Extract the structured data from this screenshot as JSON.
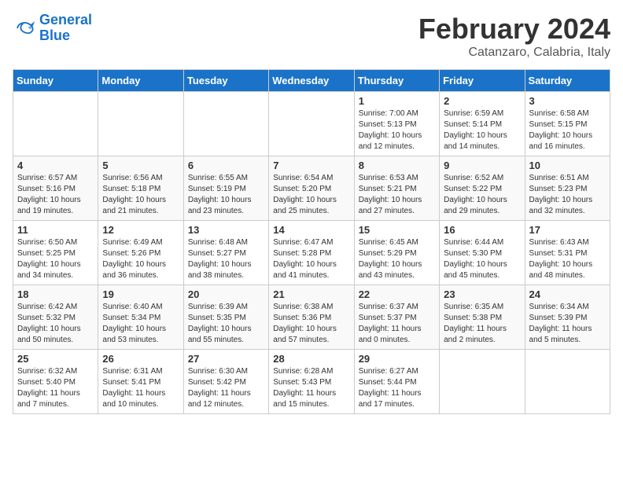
{
  "logo": {
    "line1": "General",
    "line2": "Blue"
  },
  "title": "February 2024",
  "subtitle": "Catanzaro, Calabria, Italy",
  "days_of_week": [
    "Sunday",
    "Monday",
    "Tuesday",
    "Wednesday",
    "Thursday",
    "Friday",
    "Saturday"
  ],
  "weeks": [
    [
      {
        "day": "",
        "info": ""
      },
      {
        "day": "",
        "info": ""
      },
      {
        "day": "",
        "info": ""
      },
      {
        "day": "",
        "info": ""
      },
      {
        "day": "1",
        "info": "Sunrise: 7:00 AM\nSunset: 5:13 PM\nDaylight: 10 hours\nand 12 minutes."
      },
      {
        "day": "2",
        "info": "Sunrise: 6:59 AM\nSunset: 5:14 PM\nDaylight: 10 hours\nand 14 minutes."
      },
      {
        "day": "3",
        "info": "Sunrise: 6:58 AM\nSunset: 5:15 PM\nDaylight: 10 hours\nand 16 minutes."
      }
    ],
    [
      {
        "day": "4",
        "info": "Sunrise: 6:57 AM\nSunset: 5:16 PM\nDaylight: 10 hours\nand 19 minutes."
      },
      {
        "day": "5",
        "info": "Sunrise: 6:56 AM\nSunset: 5:18 PM\nDaylight: 10 hours\nand 21 minutes."
      },
      {
        "day": "6",
        "info": "Sunrise: 6:55 AM\nSunset: 5:19 PM\nDaylight: 10 hours\nand 23 minutes."
      },
      {
        "day": "7",
        "info": "Sunrise: 6:54 AM\nSunset: 5:20 PM\nDaylight: 10 hours\nand 25 minutes."
      },
      {
        "day": "8",
        "info": "Sunrise: 6:53 AM\nSunset: 5:21 PM\nDaylight: 10 hours\nand 27 minutes."
      },
      {
        "day": "9",
        "info": "Sunrise: 6:52 AM\nSunset: 5:22 PM\nDaylight: 10 hours\nand 29 minutes."
      },
      {
        "day": "10",
        "info": "Sunrise: 6:51 AM\nSunset: 5:23 PM\nDaylight: 10 hours\nand 32 minutes."
      }
    ],
    [
      {
        "day": "11",
        "info": "Sunrise: 6:50 AM\nSunset: 5:25 PM\nDaylight: 10 hours\nand 34 minutes."
      },
      {
        "day": "12",
        "info": "Sunrise: 6:49 AM\nSunset: 5:26 PM\nDaylight: 10 hours\nand 36 minutes."
      },
      {
        "day": "13",
        "info": "Sunrise: 6:48 AM\nSunset: 5:27 PM\nDaylight: 10 hours\nand 38 minutes."
      },
      {
        "day": "14",
        "info": "Sunrise: 6:47 AM\nSunset: 5:28 PM\nDaylight: 10 hours\nand 41 minutes."
      },
      {
        "day": "15",
        "info": "Sunrise: 6:45 AM\nSunset: 5:29 PM\nDaylight: 10 hours\nand 43 minutes."
      },
      {
        "day": "16",
        "info": "Sunrise: 6:44 AM\nSunset: 5:30 PM\nDaylight: 10 hours\nand 45 minutes."
      },
      {
        "day": "17",
        "info": "Sunrise: 6:43 AM\nSunset: 5:31 PM\nDaylight: 10 hours\nand 48 minutes."
      }
    ],
    [
      {
        "day": "18",
        "info": "Sunrise: 6:42 AM\nSunset: 5:32 PM\nDaylight: 10 hours\nand 50 minutes."
      },
      {
        "day": "19",
        "info": "Sunrise: 6:40 AM\nSunset: 5:34 PM\nDaylight: 10 hours\nand 53 minutes."
      },
      {
        "day": "20",
        "info": "Sunrise: 6:39 AM\nSunset: 5:35 PM\nDaylight: 10 hours\nand 55 minutes."
      },
      {
        "day": "21",
        "info": "Sunrise: 6:38 AM\nSunset: 5:36 PM\nDaylight: 10 hours\nand 57 minutes."
      },
      {
        "day": "22",
        "info": "Sunrise: 6:37 AM\nSunset: 5:37 PM\nDaylight: 11 hours\nand 0 minutes."
      },
      {
        "day": "23",
        "info": "Sunrise: 6:35 AM\nSunset: 5:38 PM\nDaylight: 11 hours\nand 2 minutes."
      },
      {
        "day": "24",
        "info": "Sunrise: 6:34 AM\nSunset: 5:39 PM\nDaylight: 11 hours\nand 5 minutes."
      }
    ],
    [
      {
        "day": "25",
        "info": "Sunrise: 6:32 AM\nSunset: 5:40 PM\nDaylight: 11 hours\nand 7 minutes."
      },
      {
        "day": "26",
        "info": "Sunrise: 6:31 AM\nSunset: 5:41 PM\nDaylight: 11 hours\nand 10 minutes."
      },
      {
        "day": "27",
        "info": "Sunrise: 6:30 AM\nSunset: 5:42 PM\nDaylight: 11 hours\nand 12 minutes."
      },
      {
        "day": "28",
        "info": "Sunrise: 6:28 AM\nSunset: 5:43 PM\nDaylight: 11 hours\nand 15 minutes."
      },
      {
        "day": "29",
        "info": "Sunrise: 6:27 AM\nSunset: 5:44 PM\nDaylight: 11 hours\nand 17 minutes."
      },
      {
        "day": "",
        "info": ""
      },
      {
        "day": "",
        "info": ""
      }
    ]
  ]
}
